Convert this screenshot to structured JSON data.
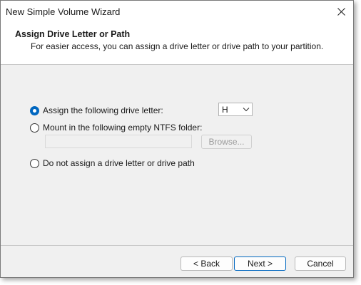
{
  "window": {
    "title": "New Simple Volume Wizard"
  },
  "header": {
    "title": "Assign Drive Letter or Path",
    "subtitle": "For easier access, you can assign a drive letter or drive path to your partition."
  },
  "options": {
    "assign_letter": {
      "label": "Assign the following drive letter:",
      "checked": true
    },
    "mount_folder": {
      "label": "Mount in the following empty NTFS folder:",
      "checked": false
    },
    "no_assign": {
      "label": "Do not assign a drive letter or drive path",
      "checked": false
    }
  },
  "drive_letter": {
    "selected": "H"
  },
  "folder_path": {
    "value": ""
  },
  "buttons": {
    "browse": "Browse...",
    "back": "< Back",
    "next": "Next >",
    "cancel": "Cancel"
  },
  "colors": {
    "accent": "#0067c0",
    "dialog_bg": "#f0f0f0",
    "header_bg": "#ffffff"
  },
  "icons": {
    "close": "close-icon",
    "dropdown": "chevron-down-icon"
  }
}
